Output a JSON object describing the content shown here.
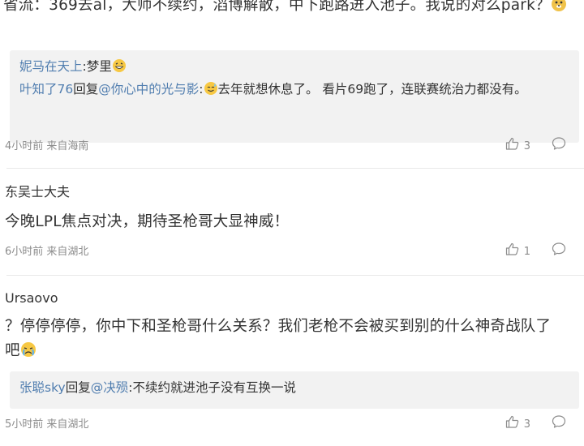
{
  "comments": [
    {
      "text": "省流：369去al，大师不续约，滔博解散，中下跑路进入池子。我说的对么park？",
      "replies": [
        {
          "user": "妮马在天上",
          "sep": ":",
          "body": "梦里"
        },
        {
          "user": "叶知了76",
          "mid": "回复",
          "target": "@你心中的光与影",
          "sep": ":",
          "body": "去年就想休息了。 看片69跑了，连联赛统治力都没有。"
        }
      ],
      "meta": "4小时前 来自海南",
      "likes": "3"
    },
    {
      "user": "东吴士大夫",
      "text": "今晚LPL焦点对决，期待圣枪哥大显神威！",
      "meta": "6小时前 来自湖北",
      "likes": "1"
    },
    {
      "user": "Ursaovo",
      "text": "？停停停停，你中下和圣枪哥什么关系？我们老枪不会被买到别的什么神奇战队了吧",
      "replies": [
        {
          "user": "张聪sky",
          "mid": "回复",
          "target": "@决殒",
          "sep": ":",
          "body": "不续约就进池子没有互换一说"
        }
      ],
      "meta": "5小时前 来自湖北",
      "likes": "3"
    }
  ],
  "icons": {
    "like": "thumbs-up-icon",
    "comment": "comment-bubble-icon",
    "emoji_doge": "doge-emoji-icon",
    "emoji_laugh": "laughing-emoji-icon",
    "emoji_sweat": "sweat-smile-emoji-icon",
    "emoji_cry": "crying-emoji-icon"
  },
  "colors": {
    "link": "#507daf",
    "meta": "#8c8c8c",
    "reply_bg": "#f2f2f2"
  }
}
